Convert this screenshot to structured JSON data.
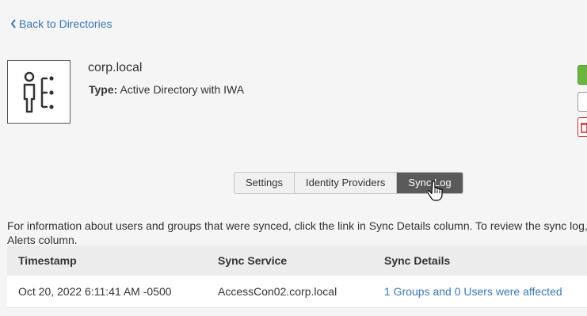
{
  "nav": {
    "back_label": "Back to Directories"
  },
  "directory": {
    "name": "corp.local",
    "type_label": "Type:",
    "type_value": "Active Directory with IWA",
    "icon": "directory-user-icon"
  },
  "tabs": [
    {
      "label": "Settings",
      "active": false
    },
    {
      "label": "Identity Providers",
      "active": false
    },
    {
      "label": "Sync Log",
      "active": true
    }
  ],
  "info": {
    "line1": "For information about users and groups that were synced, click the link in Sync Details column. To review the sync log,",
    "line2": "Alerts column."
  },
  "table": {
    "headers": [
      "Timestamp",
      "Sync Service",
      "Sync Details"
    ],
    "rows": [
      {
        "timestamp": "Oct 20, 2022 6:11:41 AM -0500",
        "service": "AccessCon02.corp.local",
        "details": "1 Groups and 0 Users were affected"
      }
    ]
  },
  "colors": {
    "link": "#3a78b4",
    "active_tab": "#5a5a5a",
    "green": "#6cb33f",
    "red": "#c9302c"
  }
}
